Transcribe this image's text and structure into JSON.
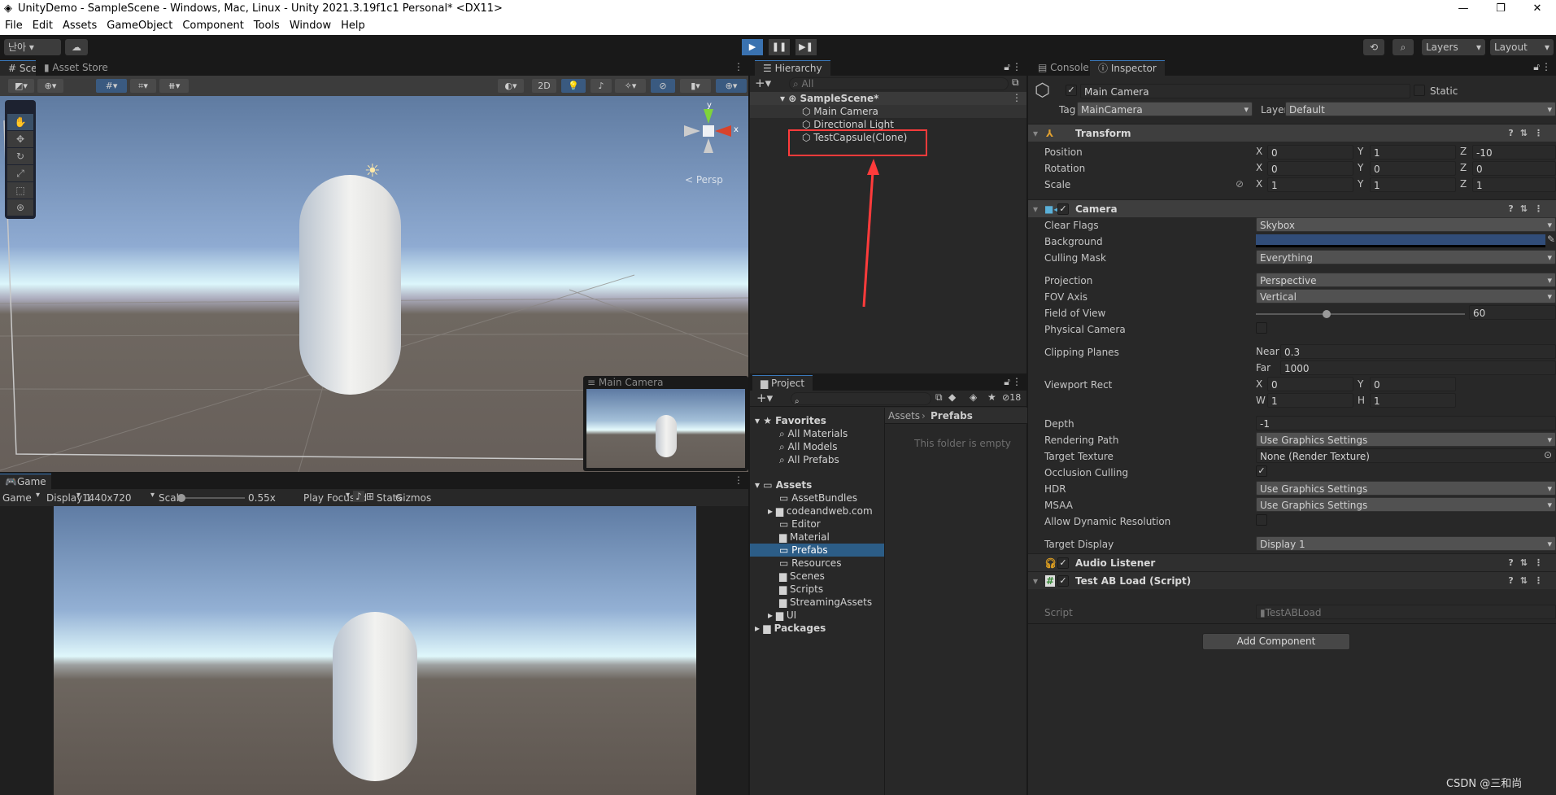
{
  "window": {
    "title": "UnityDemo - SampleScene - Windows, Mac, Linux - Unity 2021.3.19f1c1 Personal* <DX11>",
    "minimize": "—",
    "maximize": "❐",
    "close": "✕"
  },
  "menu": [
    "File",
    "Edit",
    "Assets",
    "GameObject",
    "Component",
    "Tools",
    "Window",
    "Help"
  ],
  "toolbar": {
    "account": "난아 ▾",
    "cloud": "☁",
    "play": "▶",
    "pause": "❚❚",
    "step": "▶❚",
    "history": "⟲",
    "search": "⌕",
    "layers": "Layers",
    "layout": "Layout"
  },
  "scene": {
    "tabs": [
      "# Scene",
      "Asset Store"
    ],
    "btn_2d": "2D",
    "persp": "< Persp",
    "axis_y": "y",
    "axis_x": "x",
    "camera_preview_title": "Main Camera"
  },
  "game": {
    "tab": "Game",
    "mode": "Game",
    "display": "Display 1",
    "resolution": "1440x720",
    "scale_label": "Scale",
    "scale_value": "0.55x",
    "scale_fraction": 0.05,
    "play_focused": "Play Focused",
    "stats": "Stats",
    "gizmos": "Gizmos"
  },
  "hierarchy": {
    "tab": "Hierarchy",
    "search_placeholder": "All",
    "scene": "SampleScene*",
    "items": [
      "Main Camera",
      "Directional Light",
      "TestCapsule(Clone)"
    ],
    "annotation_color": "#ff3b3b"
  },
  "project": {
    "tab": "Project",
    "hidden_count": "18",
    "favorites": "Favorites",
    "fav_items": [
      "All Materials",
      "All Models",
      "All Prefabs"
    ],
    "assets": "Assets",
    "folders": [
      "AssetBundles",
      "codeandweb.com",
      "Editor",
      "Material",
      "Prefabs",
      "Resources",
      "Scenes",
      "Scripts",
      "StreamingAssets",
      "UI"
    ],
    "packages": "Packages",
    "breadcrumb": [
      "Assets",
      "Prefabs"
    ],
    "empty": "This folder is empty",
    "selected_color": "#2c5d87"
  },
  "inspector": {
    "tabs": [
      "Console",
      "Inspector"
    ],
    "object_name": "Main Camera",
    "static": "Static",
    "tag_label": "Tag",
    "tag": "MainCamera",
    "layer_label": "Layer",
    "layer": "Default",
    "transform": {
      "title": "Transform",
      "position": {
        "label": "Position",
        "x": "0",
        "y": "1",
        "z": "-10"
      },
      "rotation": {
        "label": "Rotation",
        "x": "0",
        "y": "0",
        "z": "0"
      },
      "scale": {
        "label": "Scale",
        "x": "1",
        "y": "1",
        "z": "1"
      }
    },
    "camera": {
      "title": "Camera",
      "clear_flags_label": "Clear Flags",
      "clear_flags": "Skybox",
      "background_label": "Background",
      "background_color": "#314d79",
      "culling_mask_label": "Culling Mask",
      "culling_mask": "Everything",
      "projection_label": "Projection",
      "projection": "Perspective",
      "fov_axis_label": "FOV Axis",
      "fov_axis": "Vertical",
      "fov_label": "Field of View",
      "fov": "60",
      "fov_fraction": 0.34,
      "physical_label": "Physical Camera",
      "clipping_label": "Clipping Planes",
      "near_label": "Near",
      "near": "0.3",
      "far_label": "Far",
      "far": "1000",
      "viewport_label": "Viewport Rect",
      "vx": "0",
      "vy": "0",
      "vw": "1",
      "vh": "1",
      "depth_label": "Depth",
      "depth": "-1",
      "rendering_path_label": "Rendering Path",
      "rendering_path": "Use Graphics Settings",
      "target_texture_label": "Target Texture",
      "target_texture": "None (Render Texture)",
      "occlusion_label": "Occlusion Culling",
      "hdr_label": "HDR",
      "hdr": "Use Graphics Settings",
      "msaa_label": "MSAA",
      "msaa": "Use Graphics Settings",
      "dynres_label": "Allow Dynamic Resolution",
      "target_display_label": "Target Display",
      "target_display": "Display 1"
    },
    "audio_listener": "Audio Listener",
    "script_comp": {
      "title": "Test AB Load (Script)",
      "script_label": "Script",
      "script": "TestABLoad"
    },
    "add_component": "Add Component"
  },
  "watermark": "CSDN @三和尚"
}
